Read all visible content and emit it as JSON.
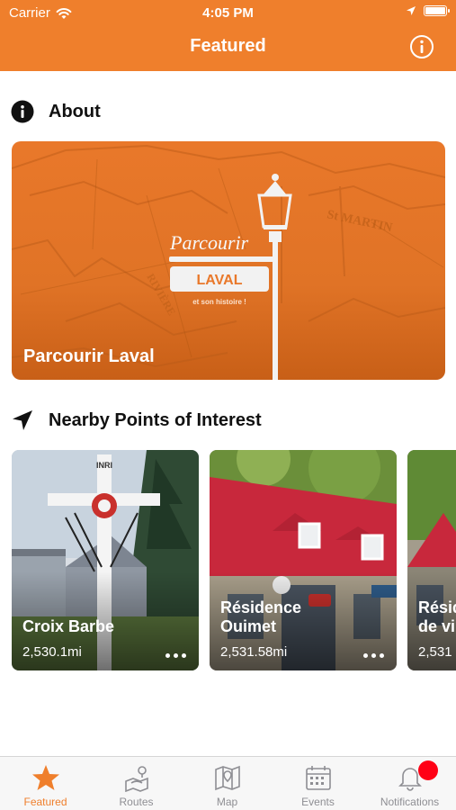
{
  "status_bar": {
    "carrier": "Carrier",
    "time": "4:05 PM"
  },
  "nav": {
    "title": "Featured"
  },
  "about": {
    "heading": "About",
    "hero_caption": "Parcourir Laval",
    "logo_line1": "Parcourir",
    "logo_line2": "LAVAL",
    "logo_line3": "et son histoire !"
  },
  "nearby": {
    "heading": "Nearby Points of Interest",
    "cards": [
      {
        "title": "Croix Barbe",
        "distance": "2,530.1mi"
      },
      {
        "title": "Résidence Ouimet",
        "distance": "2,531.58mi"
      },
      {
        "title": "Résidence de vi",
        "distance": "2,531"
      }
    ]
  },
  "tabbar": {
    "tabs": [
      {
        "label": "Featured",
        "icon": "star-icon"
      },
      {
        "label": "Routes",
        "icon": "routes-icon"
      },
      {
        "label": "Map",
        "icon": "map-icon"
      },
      {
        "label": "Events",
        "icon": "calendar-icon"
      },
      {
        "label": "Notifications",
        "icon": "bell-icon"
      }
    ]
  },
  "colors": {
    "accent": "#ef7f2c",
    "badge": "#ff0015",
    "inactive": "#8e8e93"
  }
}
